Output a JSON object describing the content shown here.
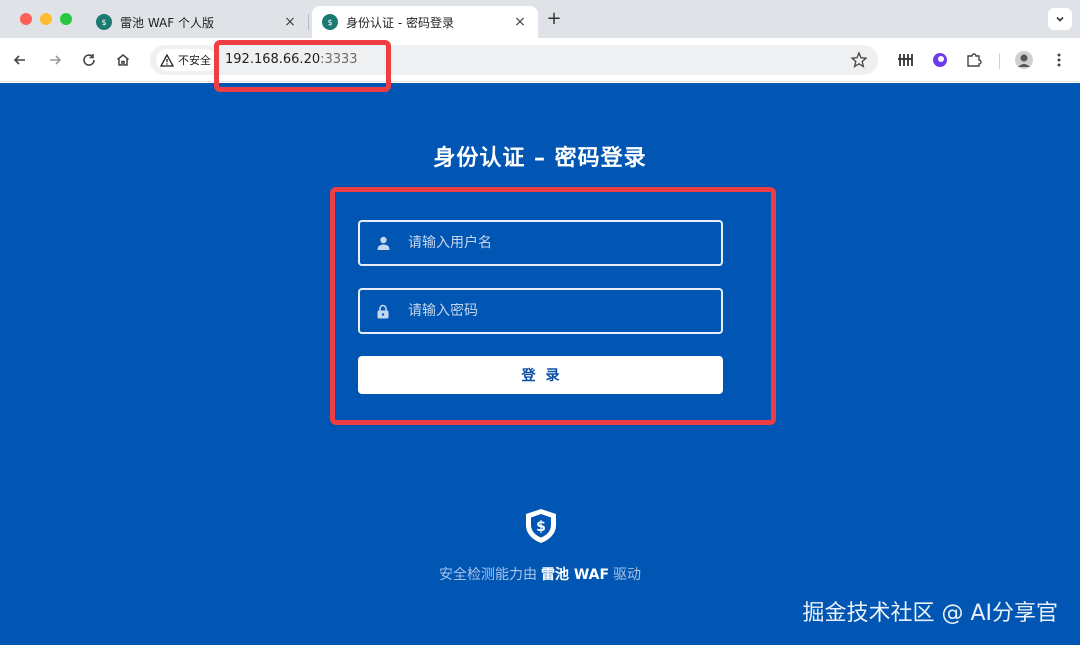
{
  "browser": {
    "tabs": [
      {
        "title": "雷池 WAF 个人版",
        "close": "×"
      },
      {
        "title": "身份认证 - 密码登录",
        "close": "×"
      }
    ],
    "new_tab": "+",
    "security_label": "不安全",
    "url_host": "192.168.66.20",
    "url_port": ":3333"
  },
  "page": {
    "title": "身份认证 – 密码登录",
    "username_placeholder": "请输入用户名",
    "password_placeholder": "请输入密码",
    "login_label": "登录",
    "footer_prefix": "安全检测能力由",
    "footer_brand": "雷池 WAF",
    "footer_suffix": "驱动"
  },
  "watermark": "掘金技术社区 @ AI分享官",
  "colors": {
    "page_bg": "#0056b2",
    "highlight": "#ef3e43",
    "favicon": "#1b7a72"
  },
  "icons": [
    "back-icon",
    "forward-icon",
    "reload-icon",
    "home-icon",
    "warning-icon",
    "star-icon",
    "user-icon",
    "lock-icon",
    "shield-logo-icon"
  ]
}
